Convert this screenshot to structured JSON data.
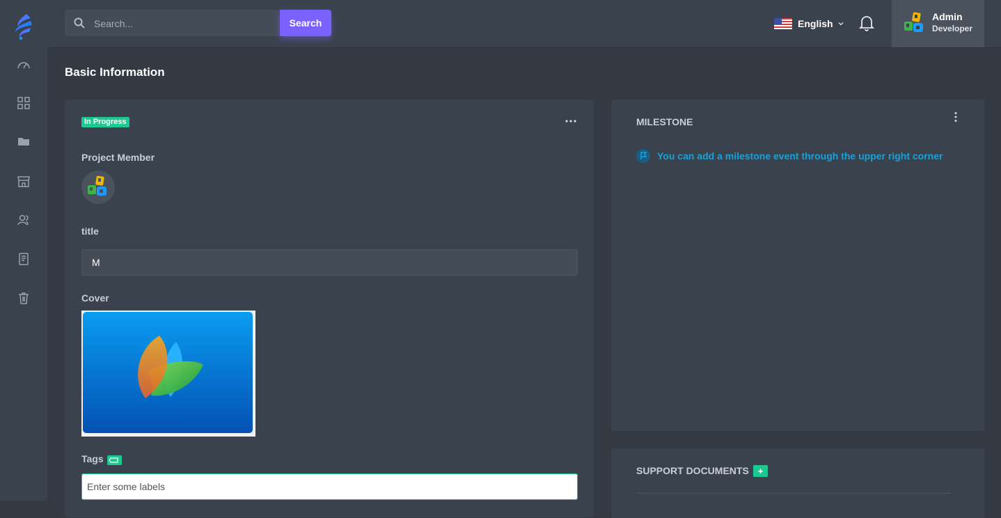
{
  "search": {
    "placeholder": "Search...",
    "button_label": "Search"
  },
  "language": {
    "label": "English"
  },
  "profile": {
    "name": "Admin",
    "role": "Developer"
  },
  "page_title": "Basic Information",
  "basic_card": {
    "status_badge": "In Progress",
    "project_member_label": "Project Member",
    "title_label": "title",
    "title_value": "M",
    "cover_label": "Cover",
    "tags_label": "Tags",
    "tags_placeholder": "Enter some labels"
  },
  "milestone": {
    "title": "MILESTONE",
    "hint": "You can add a milestone event through the upper right corner"
  },
  "support_documents": {
    "title": "SUPPORT DOCUMENTS",
    "add_label": "+"
  },
  "colors": {
    "accent": "#7b61ff",
    "status_green": "#1ec98f",
    "link_blue": "#17a2d9",
    "background": "#333a44",
    "card": "#3a424d"
  },
  "sidebar_icons": [
    "dashboard-gauge-icon",
    "apps-grid-icon",
    "folder-icon",
    "store-icon",
    "users-icon",
    "document-icon",
    "trash-icon"
  ]
}
